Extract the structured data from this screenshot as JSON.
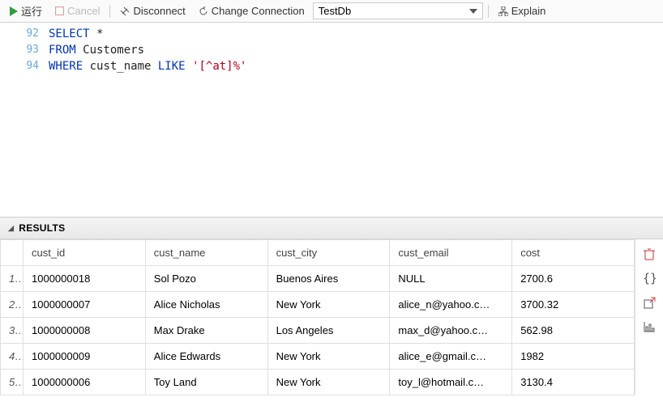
{
  "toolbar": {
    "run_label": "运行",
    "cancel_label": "Cancel",
    "disconnect_label": "Disconnect",
    "change_conn_label": "Change Connection",
    "db_name": "TestDb",
    "explain_label": "Explain"
  },
  "editor": {
    "lines": [
      {
        "num": "92",
        "tokens": [
          [
            "kw",
            "SELECT"
          ],
          [
            "op",
            " *"
          ]
        ]
      },
      {
        "num": "93",
        "tokens": [
          [
            "kw",
            "FROM"
          ],
          [
            "ident",
            " Customers"
          ]
        ]
      },
      {
        "num": "94",
        "tokens": [
          [
            "kw",
            "WHERE"
          ],
          [
            "ident",
            " cust_name "
          ],
          [
            "kw",
            "LIKE"
          ],
          [
            "op",
            " "
          ],
          [
            "str",
            "'[^at]%'"
          ]
        ]
      }
    ]
  },
  "results": {
    "title": "RESULTS",
    "columns": [
      "cust_id",
      "cust_name",
      "cust_city",
      "cust_email",
      "cost"
    ],
    "rows": [
      [
        "1000000018",
        "Sol Pozo",
        "Buenos Aires",
        "NULL",
        "2700.6"
      ],
      [
        "1000000007",
        "Alice Nicholas",
        "New York",
        "alice_n@yahoo.c…",
        "3700.32"
      ],
      [
        "1000000008",
        "Max Drake",
        "Los Angeles",
        "max_d@yahoo.c…",
        "562.98"
      ],
      [
        "1000000009",
        "Alice Edwards",
        "New York",
        "alice_e@gmail.c…",
        "1982"
      ],
      [
        "1000000006",
        "Toy Land",
        "New York",
        "toy_l@hotmail.c…",
        "3130.4"
      ]
    ]
  }
}
